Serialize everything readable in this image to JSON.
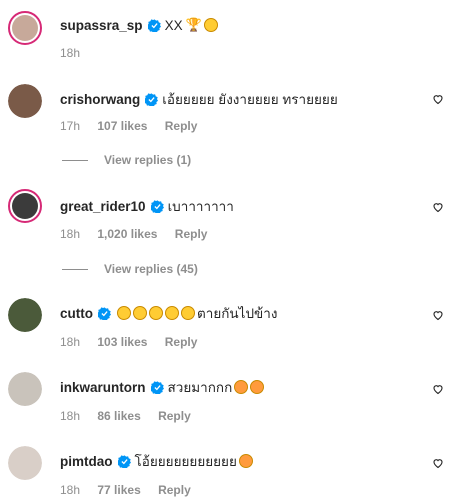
{
  "caption": {
    "username": "supassra_sp",
    "text": "XX",
    "time": "18h"
  },
  "comments": [
    {
      "username": "crishorwang",
      "text": "เอ้ยยยยย ยังงายยยย ทรายยยย",
      "time": "17h",
      "likes": "107 likes",
      "reply": "Reply",
      "view_replies": "View replies (1)",
      "avatar_color": "#7a5a48"
    },
    {
      "username": "great_rider10",
      "text": "เบาาาาาาา",
      "time": "18h",
      "likes": "1,020 likes",
      "reply": "Reply",
      "view_replies": "View replies (45)",
      "avatar_color": "#3b3b3b"
    },
    {
      "username": "cutto",
      "text": "ตายกันไปข้าง",
      "time": "18h",
      "likes": "103 likes",
      "reply": "Reply",
      "avatar_color": "#4b5a3a"
    },
    {
      "username": "inkwaruntorn",
      "text": "สวยมากกก",
      "time": "18h",
      "likes": "86 likes",
      "reply": "Reply",
      "avatar_color": "#c9c3bb"
    },
    {
      "username": "pimtdao",
      "text": "โอ้ยยยยยยยยยยย",
      "time": "18h",
      "likes": "77 likes",
      "reply": "Reply",
      "avatar_color": "#d9cfc8"
    }
  ],
  "colors": {
    "verified": "#0095f6",
    "story_ring": "#d62976",
    "muted": "#8e8e8e"
  }
}
